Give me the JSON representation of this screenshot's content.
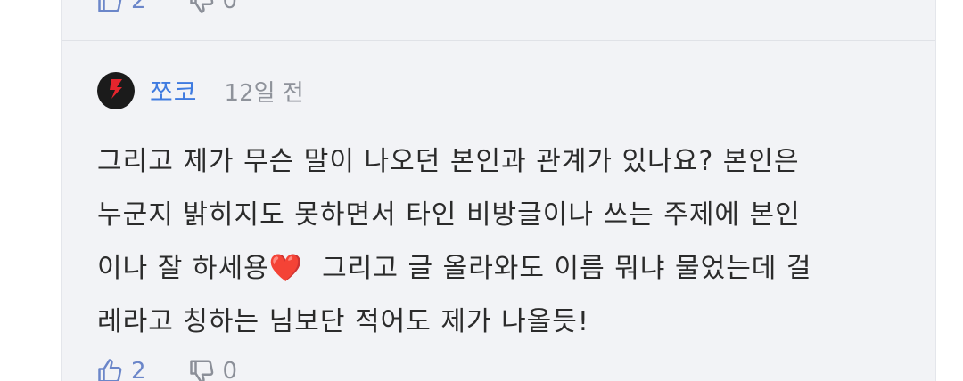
{
  "top_reactions": {
    "likes": "2",
    "dislikes": "0"
  },
  "comment": {
    "author": "쪼코",
    "time": "12일 전",
    "lines": [
      "그리고 제가 무슨 말이 나오던 본인과 관계가 있나요? 본인은",
      "누군지 밝히지도 못하면서 타인 비방글이나 쓰는 주제에 본인",
      "이나 잘 하세용",
      "  그리고 글 올라와도 이름 뭐냐 물었는데 걸",
      "레라고 칭하는 님보단 적어도 제가 나올듯!"
    ],
    "emoji": "❤️",
    "likes": "2",
    "dislikes": "0"
  },
  "colors": {
    "accent": "#3f7be0",
    "like": "#6b86c9",
    "panel": "#f2f3f6",
    "heart": "#e0202a"
  },
  "icons": [
    "thumbs-up-icon",
    "thumbs-down-icon",
    "avatar-logo-icon"
  ]
}
